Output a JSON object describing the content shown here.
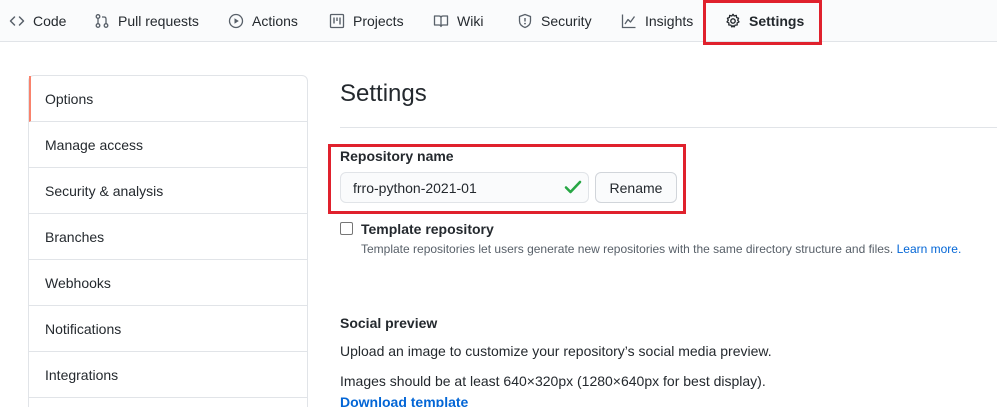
{
  "nav": {
    "tabs": [
      {
        "label": "Code",
        "icon": "code-icon"
      },
      {
        "label": "Pull requests",
        "icon": "pull-request-icon"
      },
      {
        "label": "Actions",
        "icon": "play-icon"
      },
      {
        "label": "Projects",
        "icon": "project-icon"
      },
      {
        "label": "Wiki",
        "icon": "book-icon"
      },
      {
        "label": "Security",
        "icon": "shield-icon"
      },
      {
        "label": "Insights",
        "icon": "graph-icon"
      },
      {
        "label": "Settings",
        "icon": "gear-icon",
        "selected": true
      }
    ]
  },
  "sidebar": {
    "items": [
      {
        "label": "Options",
        "active": true
      },
      {
        "label": "Manage access"
      },
      {
        "label": "Security & analysis"
      },
      {
        "label": "Branches"
      },
      {
        "label": "Webhooks"
      },
      {
        "label": "Notifications"
      },
      {
        "label": "Integrations"
      }
    ]
  },
  "main": {
    "title": "Settings",
    "repo_name_label": "Repository name",
    "repo_name_value": "frro-python-2021-01",
    "rename_button": "Rename",
    "template_label": "Template repository",
    "template_note": "Template repositories let users generate new repositories with the same directory structure and files.",
    "learn_more": "Learn more.",
    "social_preview_title": "Social preview",
    "social_preview_desc": "Upload an image to customize your repository’s social media preview.",
    "image_size_note": "Images should be at least 640×320px (1280×640px for best display).",
    "download_template": "Download template"
  },
  "colors": {
    "highlight": "#e0212d",
    "active_indicator": "#f9826c",
    "link": "#0366d6",
    "check": "#28a745"
  }
}
